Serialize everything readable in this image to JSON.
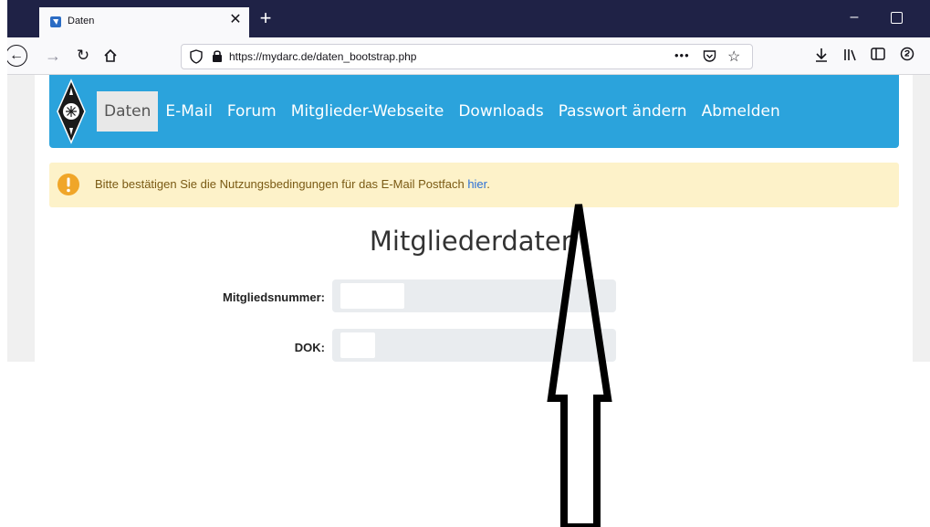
{
  "browser": {
    "tab_title": "Daten",
    "url": "https://mydarc.de/daten_bootstrap.php",
    "page_actions": "•••"
  },
  "menu": {
    "items": [
      {
        "label": "Daten",
        "active": true
      },
      {
        "label": "E-Mail"
      },
      {
        "label": "Forum"
      },
      {
        "label": "Mitglieder-Webseite"
      },
      {
        "label": "Downloads"
      },
      {
        "label": "Passwort ändern"
      },
      {
        "label": "Abmelden"
      }
    ]
  },
  "alert": {
    "text": "Bitte bestätigen Sie die Nutzungsbedingungen für das E-Mail Postfach ",
    "link": "hier",
    "suffix": "."
  },
  "form": {
    "heading": "Mitgliederdaten",
    "fields": [
      {
        "label": "Mitgliedsnummer:"
      },
      {
        "label": "DOK:"
      }
    ]
  },
  "colors": {
    "menu_bg": "#2ba3dc",
    "alert_bg": "#fdf2c9",
    "link": "#2a6fd6",
    "tabbar_bg": "#1f2246"
  }
}
